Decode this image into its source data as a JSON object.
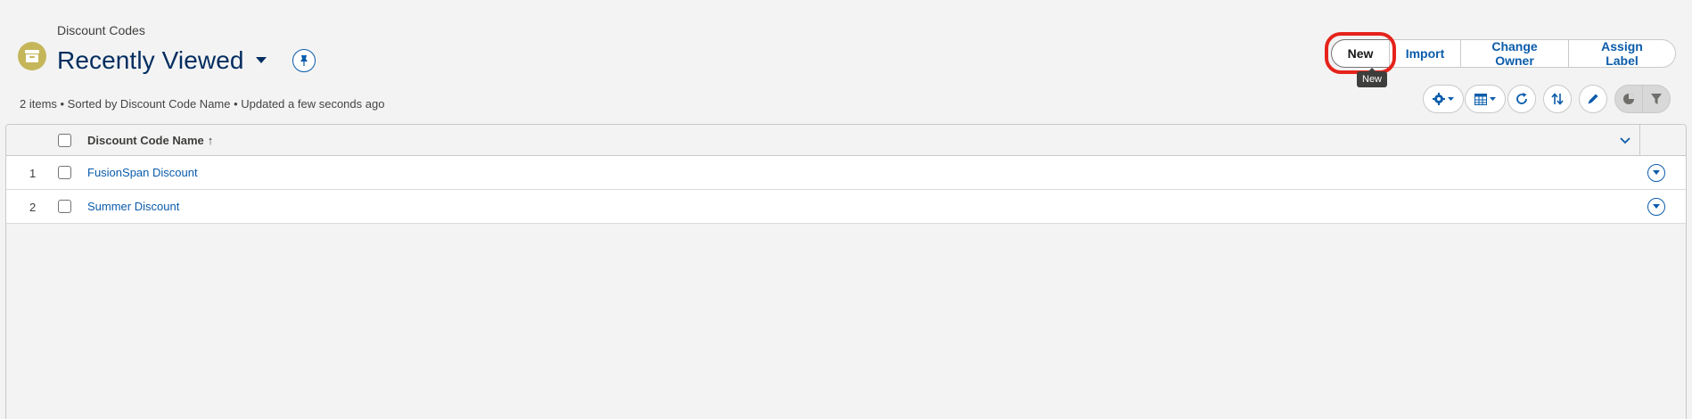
{
  "header": {
    "object_type": "Discount Codes",
    "title": "Recently Viewed",
    "meta": "2 items • Sorted by Discount Code Name • Updated a few seconds ago",
    "icon": "archive-box-icon"
  },
  "actions": {
    "new_label": "New",
    "import_label": "Import",
    "change_owner_label": "Change Owner",
    "assign_label_label": "Assign Label",
    "tooltip": "New"
  },
  "tools": [
    "settings-icon",
    "table-view-icon",
    "refresh-icon",
    "sort-icon",
    "edit-icon",
    "chart-icon",
    "filter-icon"
  ],
  "table": {
    "column_header": "Discount Code Name",
    "sort_indicator": "↑",
    "rows": [
      {
        "number": "1",
        "name": "FusionSpan Discount"
      },
      {
        "number": "2",
        "name": "Summer Discount"
      }
    ]
  },
  "colors": {
    "brand_blue": "#0b5cab",
    "title_blue": "#032d60",
    "icon_bg": "#c5b65a",
    "highlight_red": "#e5231b"
  }
}
